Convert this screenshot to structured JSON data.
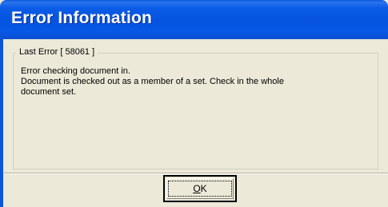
{
  "window": {
    "title": "Error Information"
  },
  "group": {
    "legend": "Last Error [ 58061 ]"
  },
  "message": {
    "line1": "Error checking document in.",
    "line2": "Document is checked out as a member of a set. Check in the whole",
    "line3": "document set."
  },
  "buttons": {
    "ok_mnemonic": "O",
    "ok_rest": "K"
  },
  "colors": {
    "titlebar": "#0553e0",
    "face": "#ece9d8",
    "title_text": "#ffffff"
  }
}
